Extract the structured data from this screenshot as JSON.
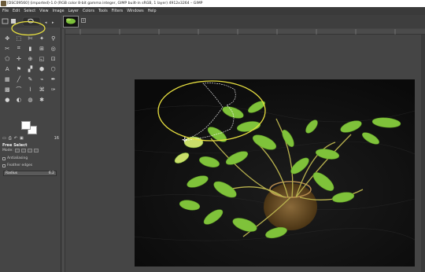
{
  "window": {
    "title": "[DSC09560] (imported)-1.0 (RGB color 8-bit gamma integer, GIMP built-in sRGB, 1 layer) 4912x3264 – GIMP"
  },
  "menu": [
    "File",
    "Edit",
    "Select",
    "View",
    "Image",
    "Layer",
    "Colors",
    "Tools",
    "Filters",
    "Windows",
    "Help"
  ],
  "tool_options": {
    "tool_name": "Free Select",
    "mode_label": "Mode:",
    "antialiasing_label": "Antialiasing",
    "feather_label": "Feather edges",
    "radius_label": "Radius",
    "radius_value": "6.2"
  },
  "tab_count": "16",
  "tools": [
    [
      "move-icon",
      "rect-select-icon",
      "free-select-icon",
      "fuzzy-select-icon",
      "zoom-icon"
    ],
    [
      "scissors-icon",
      "crop-icon",
      "eraser-icon",
      "align-icon",
      "measure-icon"
    ],
    [
      "unified-transform-icon",
      "warp-icon",
      "cage-icon",
      "flip-icon",
      "text-icon"
    ],
    [
      "bucket-fill-icon",
      "gradient-icon",
      "foreground-select-icon",
      "perspective-icon",
      "heal-icon"
    ],
    [
      "paintbrush-icon",
      "pencil-icon",
      "airbrush-icon",
      "ink-icon",
      "clone-icon"
    ],
    [
      "smudge-icon",
      "dodge-icon",
      "blur-icon",
      "path-icon",
      "color-picker-icon"
    ],
    [
      "mypaint-icon",
      "handle-icon",
      "blend-icon",
      "gegl-icon",
      "heal2-icon"
    ]
  ]
}
